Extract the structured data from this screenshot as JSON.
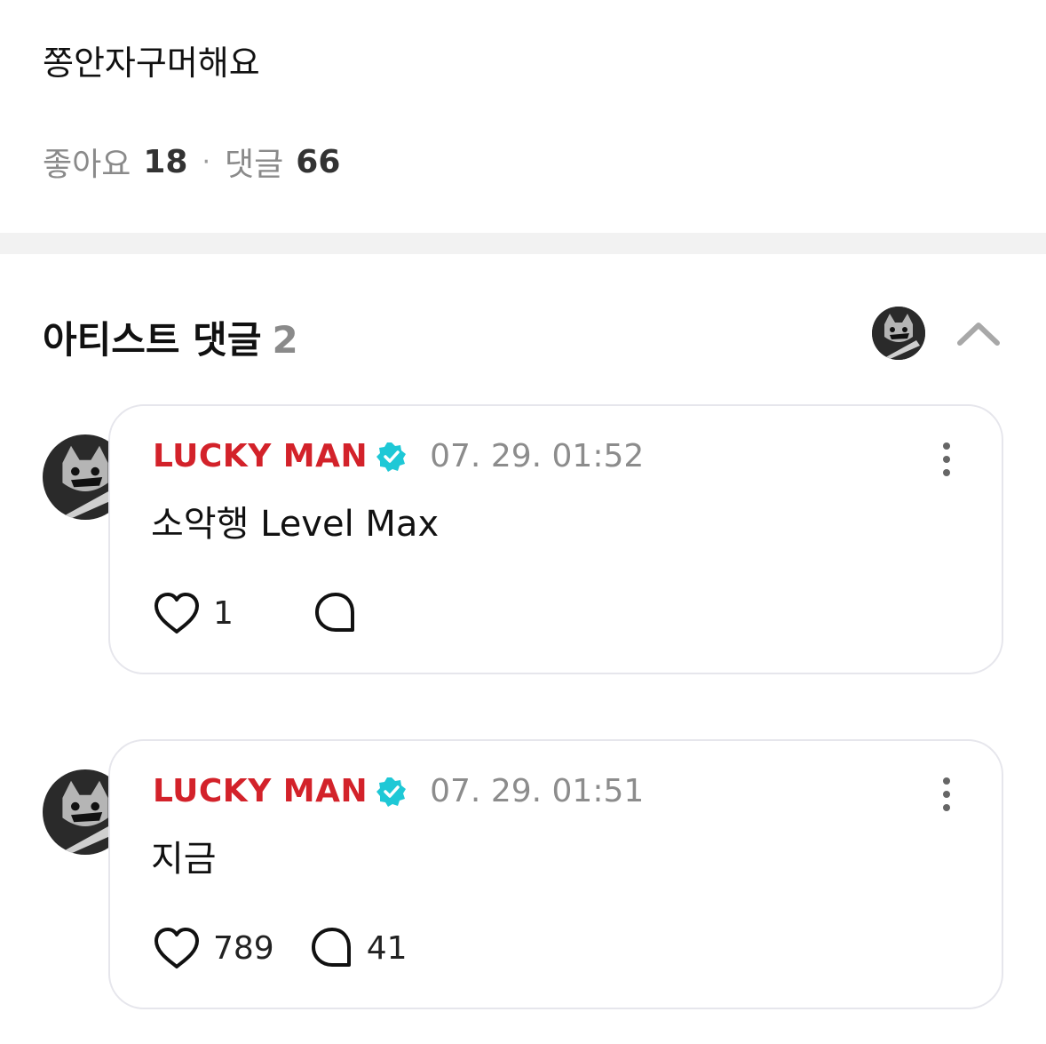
{
  "post": {
    "body": "쫑안자구머해요",
    "likes_label": "좋아요",
    "likes_count": "18",
    "separator": "·",
    "comments_label": "댓글",
    "comments_count": "66"
  },
  "artist_comments": {
    "title": "아티스트 댓글",
    "count": "2",
    "toggle_icon": "chevron-up-icon",
    "items": [
      {
        "author": "LUCKY MAN",
        "verified_icon": "verified-badge-icon",
        "timestamp": "07. 29. 01:52",
        "text": "소악행 Level Max",
        "like_count": "1",
        "reply_count": ""
      },
      {
        "author": "LUCKY MAN",
        "verified_icon": "verified-badge-icon",
        "timestamp": "07. 29. 01:51",
        "text": "지금",
        "like_count": "789",
        "reply_count": "41"
      }
    ]
  },
  "colors": {
    "author": "#d3222a",
    "verified": "#1ec8d6",
    "muted": "#8c8c8c",
    "card_border": "#e6e6ec"
  }
}
